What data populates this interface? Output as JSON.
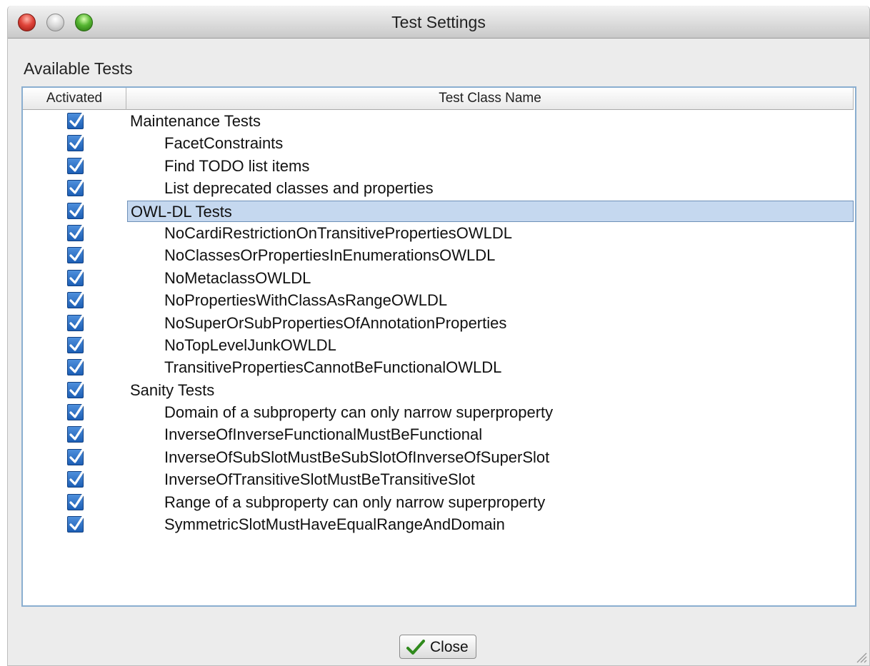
{
  "window": {
    "title": "Test Settings"
  },
  "section_label": "Available Tests",
  "table": {
    "columns": [
      "Activated",
      "Test Class Name"
    ],
    "rows": [
      {
        "name": "Maintenance Tests",
        "level": 0,
        "checked": true,
        "selected": false
      },
      {
        "name": "FacetConstraints",
        "level": 1,
        "checked": true,
        "selected": false
      },
      {
        "name": "Find TODO list items",
        "level": 1,
        "checked": true,
        "selected": false
      },
      {
        "name": "List deprecated classes and properties",
        "level": 1,
        "checked": true,
        "selected": false
      },
      {
        "name": "OWL-DL Tests",
        "level": 0,
        "checked": true,
        "selected": true
      },
      {
        "name": "NoCardiRestrictionOnTransitivePropertiesOWLDL",
        "level": 1,
        "checked": true,
        "selected": false
      },
      {
        "name": "NoClassesOrPropertiesInEnumerationsOWLDL",
        "level": 1,
        "checked": true,
        "selected": false
      },
      {
        "name": "NoMetaclassOWLDL",
        "level": 1,
        "checked": true,
        "selected": false
      },
      {
        "name": "NoPropertiesWithClassAsRangeOWLDL",
        "level": 1,
        "checked": true,
        "selected": false
      },
      {
        "name": "NoSuperOrSubPropertiesOfAnnotationProperties",
        "level": 1,
        "checked": true,
        "selected": false
      },
      {
        "name": "NoTopLevelJunkOWLDL",
        "level": 1,
        "checked": true,
        "selected": false
      },
      {
        "name": "TransitivePropertiesCannotBeFunctionalOWLDL",
        "level": 1,
        "checked": true,
        "selected": false
      },
      {
        "name": "Sanity Tests",
        "level": 0,
        "checked": true,
        "selected": false
      },
      {
        "name": "Domain of a subproperty can only narrow superproperty",
        "level": 1,
        "checked": true,
        "selected": false
      },
      {
        "name": "InverseOfInverseFunctionalMustBeFunctional",
        "level": 1,
        "checked": true,
        "selected": false
      },
      {
        "name": "InverseOfSubSlotMustBeSubSlotOfInverseOfSuperSlot",
        "level": 1,
        "checked": true,
        "selected": false
      },
      {
        "name": "InverseOfTransitiveSlotMustBeTransitiveSlot",
        "level": 1,
        "checked": true,
        "selected": false
      },
      {
        "name": "Range of a subproperty can only narrow superproperty",
        "level": 1,
        "checked": true,
        "selected": false
      },
      {
        "name": "SymmetricSlotMustHaveEqualRangeAndDomain",
        "level": 1,
        "checked": true,
        "selected": false
      }
    ]
  },
  "footer": {
    "close_label": "Close",
    "close_icon": "checkmark-icon"
  },
  "colors": {
    "selection": "#c5d8ef",
    "checkbox": "#1d5fb5",
    "table_border": "#8aaed0"
  }
}
